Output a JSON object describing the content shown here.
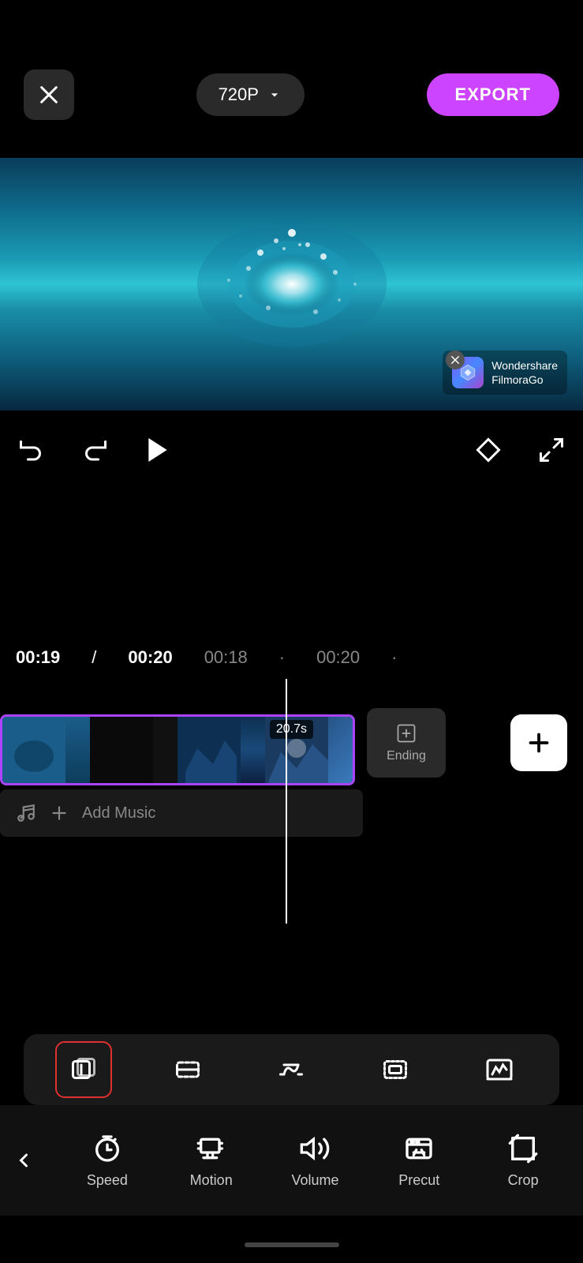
{
  "header": {
    "close_label": "×",
    "resolution": "720P",
    "export_label": "EXPORT"
  },
  "watermark": {
    "text": "Wondershare\nFilmoraGo"
  },
  "controls": {
    "undo_label": "undo",
    "redo_label": "redo",
    "play_label": "play",
    "diamond_label": "keyframe",
    "fullscreen_label": "fullscreen"
  },
  "timeline": {
    "current_time": "00:19",
    "total_time": "00:20",
    "mark1": "00:18",
    "mark2": "00:20",
    "duration": "20.7s",
    "ending_label": "Ending",
    "add_music_label": "Add Music"
  },
  "toolbar": {
    "icons": [
      {
        "name": "split-copy",
        "label": "split-copy",
        "active": true
      },
      {
        "name": "trim",
        "label": "trim",
        "active": false
      },
      {
        "name": "speed-ramp",
        "label": "speed-ramp",
        "active": false
      },
      {
        "name": "mask",
        "label": "mask",
        "active": false
      },
      {
        "name": "effects",
        "label": "effects",
        "active": false
      }
    ]
  },
  "bottom_nav": {
    "back_label": "<",
    "items": [
      {
        "name": "speed",
        "label": "Speed"
      },
      {
        "name": "motion",
        "label": "Motion"
      },
      {
        "name": "volume",
        "label": "Volume"
      },
      {
        "name": "precut",
        "label": "Precut"
      },
      {
        "name": "crop",
        "label": "Crop"
      }
    ]
  }
}
